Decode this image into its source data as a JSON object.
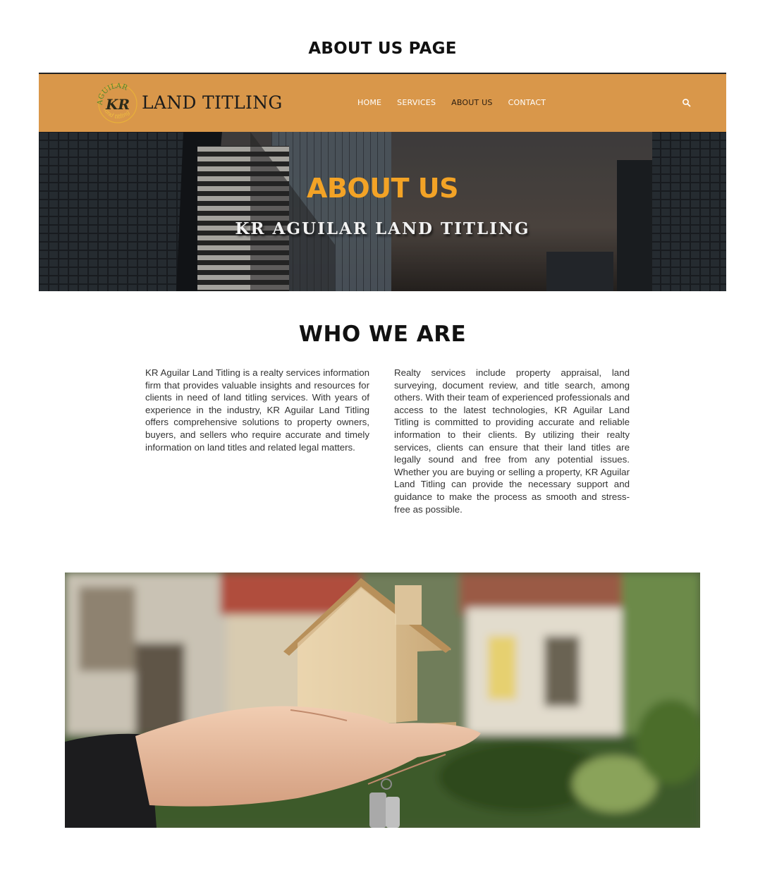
{
  "page": {
    "heading": "ABOUT US PAGE"
  },
  "navbar": {
    "brand": "LAND TITLING",
    "logo_monogram": "KR",
    "logo_ring_text": "AGUILAR land titling",
    "links": [
      {
        "label": "HOME",
        "active": false
      },
      {
        "label": "SERVICES",
        "active": false
      },
      {
        "label": "ABOUT US",
        "active": true
      },
      {
        "label": "CONTACT",
        "active": false
      }
    ],
    "search_icon": "search-icon",
    "bg_color": "#d9974a"
  },
  "hero": {
    "title": "ABOUT US",
    "subtitle": "KR AGUILAR LAND TITLING",
    "title_color": "#f3a326"
  },
  "who_we_are": {
    "title": "WHO WE ARE",
    "left": "KR Aguilar Land Titling is a realty services information firm that provides valuable insights and resources for clients in need of land titling services. With years of experience in the industry, KR Aguilar Land Titling offers comprehensive solutions to property owners, buyers, and sellers who require accurate and timely information on land titles and related legal matters.",
    "right": "Realty services include property appraisal, land surveying, document review, and title search, among others. With their team of experienced professionals and access to the latest technologies, KR Aguilar Land Titling is committed to providing accurate and reliable information to their clients. By utilizing their realty services, clients can ensure that their land titles are legally sound and free from any potential issues. Whether you are buying or selling a property, KR Aguilar Land Titling can provide the necessary support and guidance to make the process as smooth and stress-free as possible."
  }
}
